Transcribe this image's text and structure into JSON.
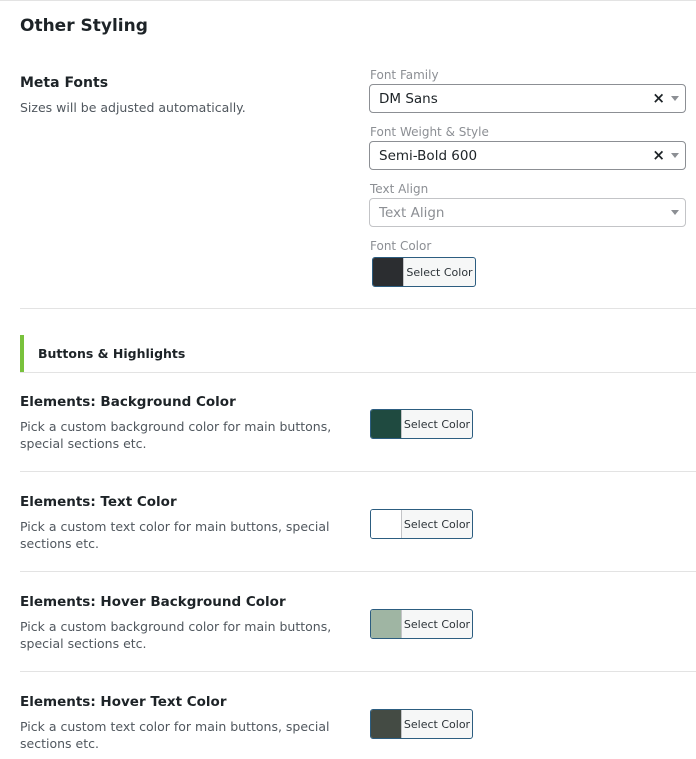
{
  "section": {
    "title": "Other Styling"
  },
  "meta_fonts": {
    "heading": "Meta Fonts",
    "description": "Sizes will be adjusted automatically.",
    "font_family": {
      "label": "Font Family",
      "value": "DM Sans"
    },
    "font_weight": {
      "label": "Font Weight & Style",
      "value": "Semi-Bold 600"
    },
    "text_align": {
      "label": "Text Align",
      "placeholder": "Text Align"
    },
    "font_color": {
      "label": "Font Color",
      "button_label": "Select Color",
      "color": "#2b2d30"
    }
  },
  "group": {
    "title": "Buttons & Highlights",
    "accent": "#79c23c"
  },
  "elements": [
    {
      "heading": "Elements: Background Color",
      "description": "Pick a custom background color for main buttons, special sections etc.",
      "button_label": "Select Color",
      "color": "#1f4a40"
    },
    {
      "heading": "Elements: Text Color",
      "description": "Pick a custom text color for main buttons, special sections etc.",
      "button_label": "Select Color",
      "color": "#ffffff"
    },
    {
      "heading": "Elements: Hover Background Color",
      "description": "Pick a custom background color for main buttons, special sections etc.",
      "button_label": "Select Color",
      "color": "#9fb5a3"
    },
    {
      "heading": "Elements: Hover Text Color",
      "description": "Pick a custom text color for main buttons, special sections etc.",
      "button_label": "Select Color",
      "color": "#444b44"
    }
  ]
}
